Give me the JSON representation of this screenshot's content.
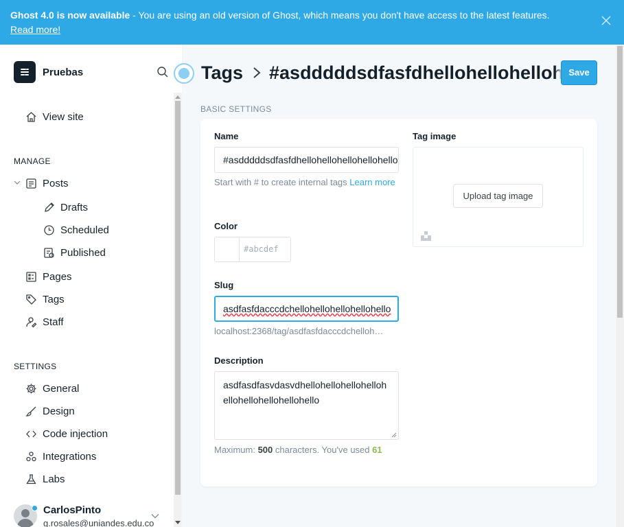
{
  "banner": {
    "title": "Ghost 4.0 is now available",
    "message": " - You are using an old version of Ghost, which means you don't have access to the latest features.",
    "link": "Read more!"
  },
  "sidebar": {
    "site_name": "Pruebas",
    "view_site": "View site",
    "manage_label": "MANAGE",
    "posts": "Posts",
    "drafts": "Drafts",
    "scheduled": "Scheduled",
    "published": "Published",
    "pages": "Pages",
    "tags": "Tags",
    "staff": "Staff",
    "settings_label": "SETTINGS",
    "general": "General",
    "design": "Design",
    "code_injection": "Code injection",
    "integrations": "Integrations",
    "labs": "Labs",
    "user_name": "CarlosPinto",
    "user_email": "g.rosales@uniandes.edu.co"
  },
  "header": {
    "crumb_parent": "Tags",
    "crumb_current": "#asdddddsdfasfdhellohellohellohello",
    "save": "Save"
  },
  "form": {
    "section": "BASIC SETTINGS",
    "name_label": "Name",
    "name_value": "#asdddddsdfasfdhellohellohellohellohello",
    "name_hint": "Start with # to create internal tags ",
    "name_hint_link": "Learn more",
    "color_label": "Color",
    "color_placeholder": "#abcdef",
    "slug_label": "Slug",
    "slug_value": "asdfasfdacccdchellohellohellohellohello",
    "slug_url": "localhost:2368/tag/asdfasfdacccdchelloh…",
    "description_label": "Description",
    "description_value": "asdfasdfasvdasvdhellohellohellohellohellohellohellohellohello",
    "max_prefix": "Maximum: ",
    "max_count": "500",
    "max_middle": " characters. You've used ",
    "used_count": "61",
    "tag_image_label": "Tag image",
    "upload_button": "Upload tag image"
  },
  "colors": {
    "accent": "#2fa8e6",
    "used_count": "#8cba4e"
  }
}
